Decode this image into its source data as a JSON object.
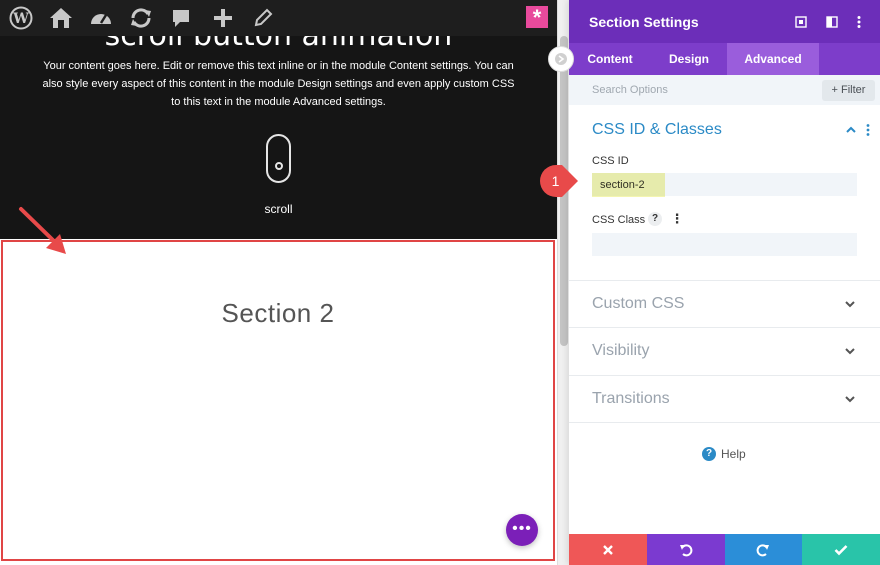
{
  "canvas": {
    "hero": {
      "title": "scroll button animation",
      "body": "Your content goes here. Edit or remove this text inline or in the module Content settings. You can also style every aspect of this content in the module Design settings and even apply custom CSS to this text in the module Advanced settings.",
      "scroll_label": "scroll"
    },
    "section2": {
      "title": "Section 2"
    },
    "toolbar_icons": [
      "wordpress-icon",
      "home-icon",
      "dashboard-icon",
      "refresh-icon",
      "comment-icon",
      "plus-icon",
      "pencil-icon",
      "divi-star-icon"
    ]
  },
  "panel": {
    "title": "Section Settings",
    "tabs": [
      {
        "label": "Content"
      },
      {
        "label": "Design"
      },
      {
        "label": "Advanced"
      }
    ],
    "search": {
      "placeholder": "Search Options",
      "filter_label": "Filter"
    },
    "css_group": {
      "title": "CSS ID & Classes",
      "css_id_label": "CSS ID",
      "css_id_value": "section-2",
      "css_class_label": "CSS Class",
      "css_class_value": ""
    },
    "groups": [
      {
        "label": "Custom CSS"
      },
      {
        "label": "Visibility"
      },
      {
        "label": "Transitions"
      }
    ],
    "help_label": "Help",
    "footer_colors": {
      "discard": "#ef5757",
      "undo": "#7b3ad0",
      "redo": "#2b8ed8",
      "save": "#29c4a9"
    }
  },
  "annotation": {
    "step": "1"
  },
  "colors": {
    "accent": "#6c2eb9",
    "highlight": "#f4f5b0",
    "annotation": "#e84a4a"
  }
}
